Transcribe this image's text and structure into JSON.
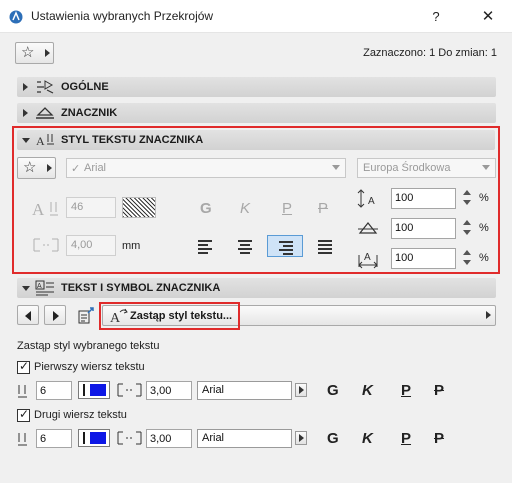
{
  "window": {
    "title": "Ustawienia wybranych Przekrojów",
    "help_label": "?",
    "close_label": "✕"
  },
  "header": {
    "selection_status": "Zaznaczono: 1 Do zmian: 1"
  },
  "sections": {
    "general": "OGÓLNE",
    "marker": "ZNACZNIK",
    "marker_text_style": "STYL TEKSTU ZNACZNIKA",
    "marker_text_symbol": "TEKST I SYMBOL ZNACZNIKA"
  },
  "text_style": {
    "font": "Arial",
    "script": "Europa Środkowa",
    "size": "46",
    "spacing": "4,00",
    "spacing_unit": "mm",
    "style_bold": "G",
    "style_italic": "K",
    "style_underline": "P",
    "style_strike": "P",
    "width_pct": "100",
    "height_pct": "100",
    "spacing_pct": "100",
    "pct_unit": "%"
  },
  "replace": {
    "button_label": "Zastąp styl tekstu...",
    "heading": "Zastąp styl wybranego tekstu"
  },
  "first_line": {
    "label": "Pierwszy wiersz tekstu",
    "checked": true,
    "pen": "6",
    "color": "#0d17e6",
    "spacing": "3,00",
    "font": "Arial",
    "style_bold": "G",
    "style_italic": "K",
    "style_underline": "P",
    "style_strike": "P"
  },
  "second_line": {
    "label": "Drugi wiersz tekstu",
    "checked": true,
    "pen": "6",
    "color": "#0d17e6",
    "spacing": "3,00",
    "font": "Arial",
    "style_bold": "G",
    "style_italic": "K",
    "style_underline": "P",
    "style_strike": "P"
  },
  "colors": {
    "highlight_border": "#e02b2b",
    "selected_align": "#cfe3f7",
    "pen_color": "#0d17e6"
  }
}
